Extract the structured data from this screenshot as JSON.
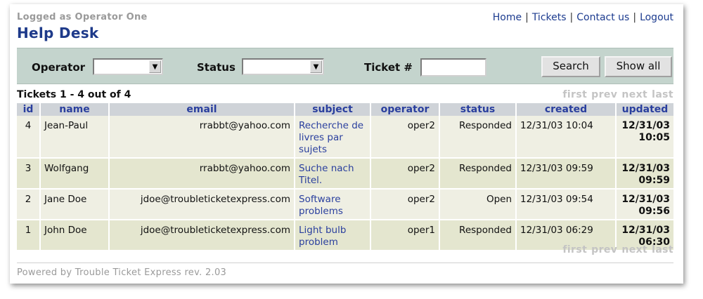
{
  "header": {
    "logged_as": "Logged as Operator One",
    "title": "Help Desk",
    "nav": [
      "Home",
      "Tickets",
      "Contact us",
      "Logout"
    ],
    "nav_sep": "|"
  },
  "search": {
    "operator_label": "Operator",
    "operator_value": "",
    "status_label": "Status",
    "status_value": "",
    "ticket_label": "Ticket #",
    "ticket_value": "",
    "search_button": "Search",
    "show_all_button": "Show all",
    "arrow_glyph": "▼"
  },
  "summary": "Tickets 1 - 4 out of 4",
  "pager": [
    "first",
    "prev",
    "next",
    "last"
  ],
  "table": {
    "columns": [
      "id",
      "name",
      "email",
      "subject",
      "operator",
      "status",
      "created",
      "updated"
    ],
    "rows": [
      {
        "id": "4",
        "name": "Jean-Paul",
        "email": "rrabbt@yahoo.com",
        "subject": "Recherche de livres par sujets",
        "operator": "oper2",
        "status": "Responded",
        "created": "12/31/03 10:04",
        "updated": "12/31/03 10:05"
      },
      {
        "id": "3",
        "name": "Wolfgang",
        "email": "rrabbt@yahoo.com",
        "subject": "Suche nach Titel.",
        "operator": "oper2",
        "status": "Responded",
        "created": "12/31/03 09:59",
        "updated": "12/31/03 09:59"
      },
      {
        "id": "2",
        "name": "Jane Doe",
        "email": "jdoe@troubleticketexpress.com",
        "subject": "Software problems",
        "operator": "oper2",
        "status": "Open",
        "created": "12/31/03 09:54",
        "updated": "12/31/03 09:56"
      },
      {
        "id": "1",
        "name": "John Doe",
        "email": "jdoe@troubleticketexpress.com",
        "subject": "Light bulb problem",
        "operator": "oper1",
        "status": "Responded",
        "created": "12/31/03 06:29",
        "updated": "12/31/03 06:30"
      }
    ]
  },
  "footer": "Powered by Trouble Ticket Express rev. 2.03",
  "colors": {
    "title": "#1e3a8a",
    "link": "#1c3b8f",
    "search_bar": "#c4d4cd",
    "row_odd": "#efefe3",
    "row_even": "#e4e6cf",
    "header_bg": "#cfd3d8"
  }
}
